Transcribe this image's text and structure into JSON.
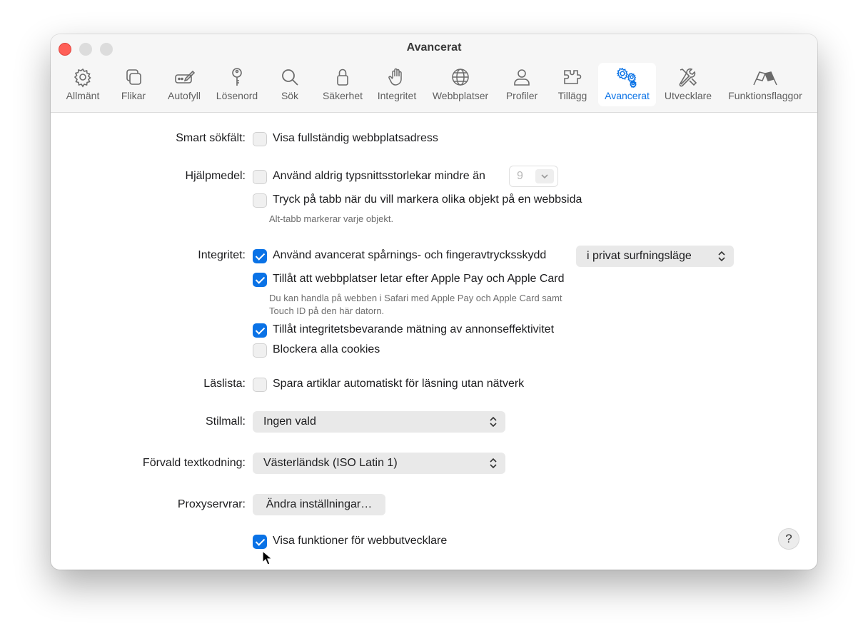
{
  "window": {
    "title": "Avancerat"
  },
  "toolbar": {
    "tabs": [
      {
        "label": "Allmänt",
        "icon": "gear-icon"
      },
      {
        "label": "Flikar",
        "icon": "tabs-icon"
      },
      {
        "label": "Autofyll",
        "icon": "pencil-field-icon"
      },
      {
        "label": "Lösenord",
        "icon": "key-icon"
      },
      {
        "label": "Sök",
        "icon": "magnifier-icon"
      },
      {
        "label": "Säkerhet",
        "icon": "lock-icon"
      },
      {
        "label": "Integritet",
        "icon": "hand-icon"
      },
      {
        "label": "Webbplatser",
        "icon": "globe-icon"
      },
      {
        "label": "Profiler",
        "icon": "person-icon"
      },
      {
        "label": "Tillägg",
        "icon": "puzzle-icon"
      },
      {
        "label": "Avancerat",
        "icon": "gears-icon",
        "active": true
      },
      {
        "label": "Utvecklare",
        "icon": "wrench-screwdriver-icon"
      },
      {
        "label": "Funktionsflaggor",
        "icon": "flags-icon"
      }
    ],
    "accent": "#0a72e6"
  },
  "smart_search": {
    "label": "Smart sökfält:",
    "show_full_address": {
      "label": "Visa fullständig webbplatsadress",
      "checked": false
    }
  },
  "accessibility": {
    "label": "Hjälpmedel:",
    "min_font": {
      "label": "Använd aldrig typsnittsstorlekar mindre än",
      "checked": false,
      "value": "9"
    },
    "tab_highlight": {
      "label": "Tryck på tabb när du vill markera olika objekt på en webbsida",
      "checked": false
    },
    "note": "Alt-tabb markerar varje objekt."
  },
  "privacy": {
    "label": "Integritet:",
    "tracking": {
      "label": "Använd avancerat spårnings- och fingeravtrycksskydd",
      "checked": true,
      "option": "i privat surfningsläge"
    },
    "apple_pay": {
      "label": "Tillåt att webbplatser letar efter Apple Pay och Apple Card",
      "checked": true
    },
    "apple_pay_note_1": "Du kan handla på webben i Safari med Apple Pay och Apple Card samt",
    "apple_pay_note_2": "Touch ID på den här datorn.",
    "ad_measurement": {
      "label": "Tillåt integritetsbevarande mätning av annonseffektivitet",
      "checked": true
    },
    "block_cookies": {
      "label": "Blockera alla cookies",
      "checked": false
    }
  },
  "reading_list": {
    "label": "Läslista:",
    "offline": {
      "label": "Spara artiklar automatiskt för läsning utan nätverk",
      "checked": false
    }
  },
  "stylesheet": {
    "label": "Stilmall:",
    "value": "Ingen vald"
  },
  "encoding": {
    "label": "Förvald textkodning:",
    "value": "Västerländsk (ISO Latin 1)"
  },
  "proxies": {
    "label": "Proxyservrar:",
    "button": "Ändra inställningar…"
  },
  "developer": {
    "label": "Visa funktioner för webbutvecklare",
    "checked": true
  },
  "help": {
    "label": "?"
  }
}
